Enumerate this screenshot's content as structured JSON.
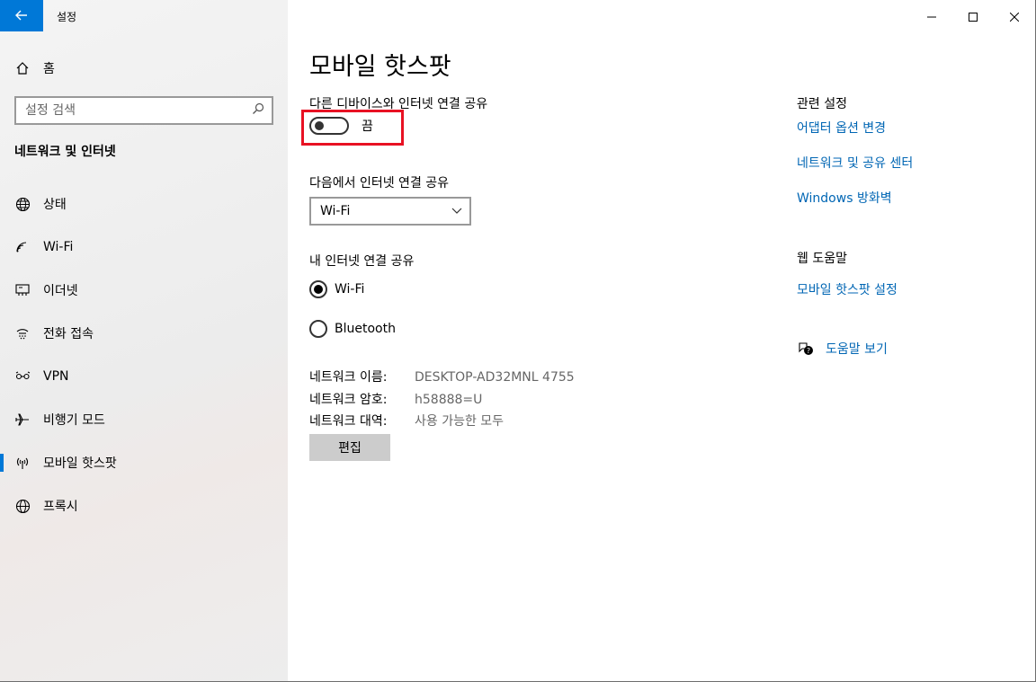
{
  "window": {
    "app_title": "설정",
    "back_icon": "back-arrow-icon",
    "caption_buttons": [
      "minimize",
      "maximize",
      "close"
    ]
  },
  "sidebar": {
    "home_label": "홈",
    "search": {
      "placeholder": "설정 검색",
      "value": ""
    },
    "section_title": "네트워크 및 인터넷",
    "items": [
      {
        "label": "상태",
        "icon": "globe-status-icon",
        "active": false
      },
      {
        "label": "Wi-Fi",
        "icon": "wifi-icon",
        "active": false
      },
      {
        "label": "이더넷",
        "icon": "ethernet-icon",
        "active": false
      },
      {
        "label": "전화 접속",
        "icon": "dialup-icon",
        "active": false
      },
      {
        "label": "VPN",
        "icon": "vpn-icon",
        "active": false
      },
      {
        "label": "비행기 모드",
        "icon": "airplane-icon",
        "active": false
      },
      {
        "label": "모바일 핫스팟",
        "icon": "hotspot-icon",
        "active": true
      },
      {
        "label": "프록시",
        "icon": "globe-icon",
        "active": false
      }
    ]
  },
  "main": {
    "title": "모바일 핫스팟",
    "share_label": "다른 디바이스와 인터넷 연결 공유",
    "toggle_state": "끔",
    "toggle_on": false,
    "share_from_label": "다음에서 인터넷 연결 공유",
    "share_from_value": "Wi-Fi",
    "share_over_label": "내 인터넷 연결 공유",
    "share_over_options": [
      {
        "label": "Wi-Fi",
        "checked": true
      },
      {
        "label": "Bluetooth",
        "checked": false
      }
    ],
    "network_info": [
      {
        "key": "네트워크 이름:",
        "value": "DESKTOP-AD32MNL 4755"
      },
      {
        "key": "네트워크 암호:",
        "value": "h58888=U"
      },
      {
        "key": "네트워크 대역:",
        "value": "사용 가능한 모두"
      }
    ],
    "edit_button": "편집"
  },
  "related": {
    "heading": "관련 설정",
    "links": [
      "어댑터 옵션 변경",
      "네트워크 및 공유 센터",
      "Windows 방화벽"
    ],
    "help_heading": "웹 도움말",
    "help_links": [
      "모바일 핫스팟 설정"
    ],
    "get_help": "도움말 보기"
  },
  "colors": {
    "accent": "#0078d7",
    "link": "#0066b4",
    "highlight": "#e81123"
  }
}
